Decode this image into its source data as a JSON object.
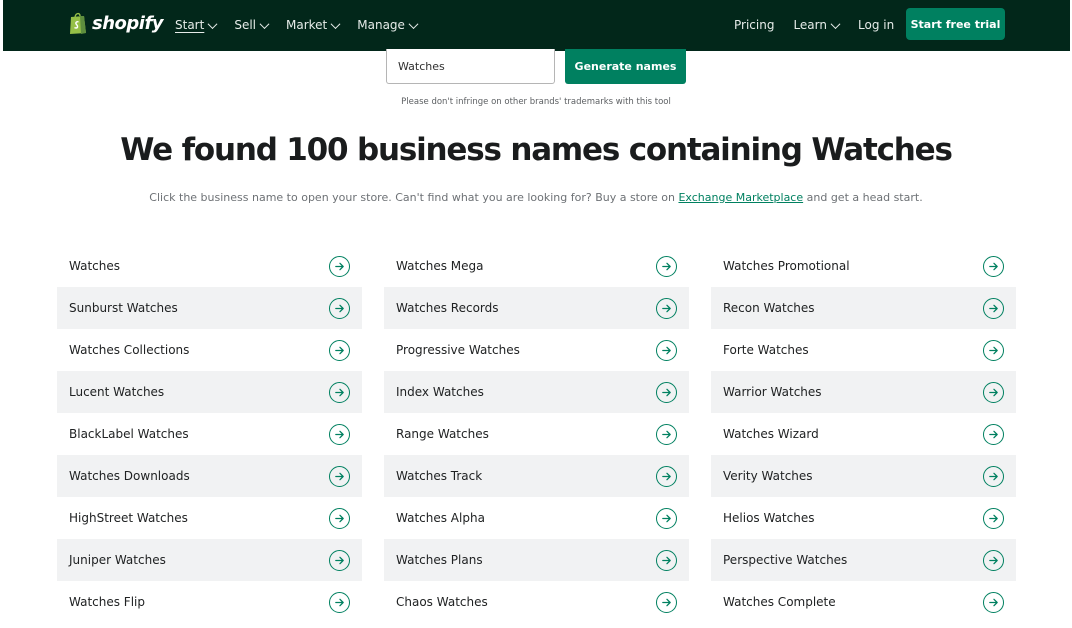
{
  "brand": {
    "name": "shopify"
  },
  "nav": {
    "left": [
      {
        "label": "Start"
      },
      {
        "label": "Sell"
      },
      {
        "label": "Market"
      },
      {
        "label": "Manage"
      }
    ],
    "pricing": "Pricing",
    "learn": "Learn",
    "login": "Log in",
    "cta": "Start free trial"
  },
  "search": {
    "value": "Watches",
    "button": "Generate names"
  },
  "disclaimer": "Please don't infringe on other brands' trademarks with this tool",
  "headline": "We found 100 business names containing Watches",
  "subtext": {
    "before": "Click the business name to open your store. Can't find what you are looking for? Buy a store on ",
    "link": "Exchange Marketplace",
    "after": " and get a head start."
  },
  "columns": [
    [
      "Watches",
      "Sunburst Watches",
      "Watches Collections",
      "Lucent Watches",
      "BlackLabel Watches",
      "Watches Downloads",
      "HighStreet Watches",
      "Juniper Watches",
      "Watches Flip"
    ],
    [
      "Watches Mega",
      "Watches Records",
      "Progressive Watches",
      "Index Watches",
      "Range Watches",
      "Watches Track",
      "Watches Alpha",
      "Watches Plans",
      "Chaos Watches"
    ],
    [
      "Watches Promotional",
      "Recon Watches",
      "Forte Watches",
      "Warrior Watches",
      "Watches Wizard",
      "Verity Watches",
      "Helios Watches",
      "Perspective Watches",
      "Watches Complete"
    ]
  ],
  "colors": {
    "nav_bg": "#02271a",
    "accent": "#008060",
    "row_shade": "#f1f2f3"
  },
  "icons": {
    "row_action": "arrow-right-circle-icon",
    "chevron": "chevron-down-icon"
  }
}
